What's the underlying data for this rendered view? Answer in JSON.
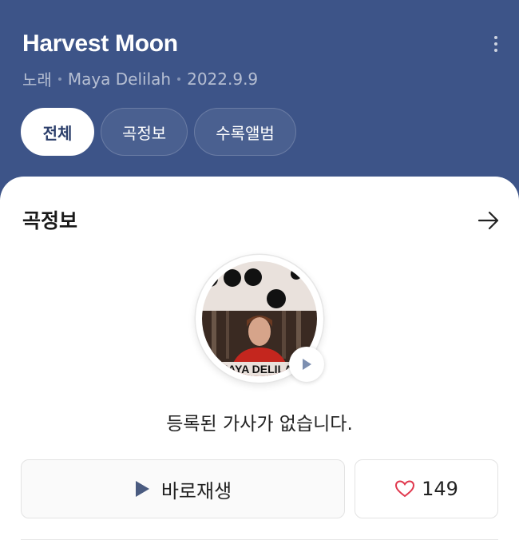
{
  "header": {
    "title": "Harvest Moon",
    "meta": {
      "type": "노래",
      "artist": "Maya Delilah",
      "date": "2022.9.9"
    },
    "tabs": [
      {
        "label": "전체",
        "active": true
      },
      {
        "label": "곡정보",
        "active": false
      },
      {
        "label": "수록앨범",
        "active": false
      }
    ],
    "colors": {
      "background": "#3d5488"
    }
  },
  "section": {
    "title": "곡정보",
    "cover": {
      "artist_text": "MAYA DELILAH"
    },
    "empty_lyrics": "등록된 가사가 없습니다.",
    "play_button_label": "바로재생",
    "like_count": "149"
  },
  "icons": [
    "more-vertical-icon",
    "arrow-right-icon",
    "play-icon",
    "heart-icon"
  ]
}
